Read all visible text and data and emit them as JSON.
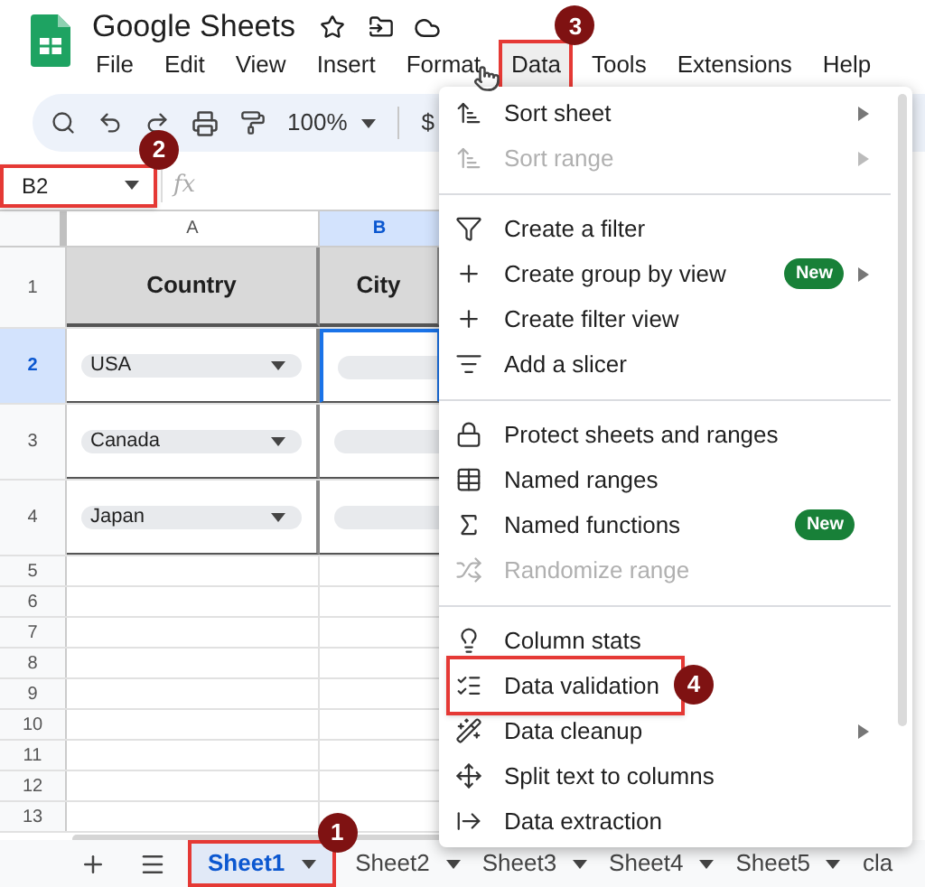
{
  "app": {
    "title": "Google Sheets",
    "menu": [
      {
        "label": "File"
      },
      {
        "label": "Edit"
      },
      {
        "label": "View"
      },
      {
        "label": "Insert"
      },
      {
        "label": "Format"
      },
      {
        "label": "Data",
        "callout": "3"
      },
      {
        "label": "Tools"
      },
      {
        "label": "Extensions"
      },
      {
        "label": "Help"
      }
    ]
  },
  "toolbar": {
    "zoom": "100%",
    "currency": "$"
  },
  "name_box": {
    "value": "B2",
    "callout": "2"
  },
  "formula_bar": {
    "label": "fx"
  },
  "grid": {
    "columns": [
      {
        "label": "A",
        "selected": false
      },
      {
        "label": "B",
        "selected": true
      }
    ],
    "rows": [
      {
        "label": "1",
        "selected": false,
        "kind": "header",
        "cells": [
          "Country",
          "City"
        ]
      },
      {
        "label": "2",
        "selected": true,
        "kind": "chips",
        "cells": [
          "USA"
        ]
      },
      {
        "label": "3",
        "selected": false,
        "kind": "chips",
        "cells": [
          "Canada"
        ]
      },
      {
        "label": "4",
        "selected": false,
        "kind": "chips",
        "cells": [
          "Japan"
        ]
      },
      {
        "label": "5",
        "selected": false,
        "kind": "empty"
      },
      {
        "label": "6",
        "selected": false,
        "kind": "empty"
      },
      {
        "label": "7",
        "selected": false,
        "kind": "empty"
      },
      {
        "label": "8",
        "selected": false,
        "kind": "empty"
      },
      {
        "label": "9",
        "selected": false,
        "kind": "empty"
      },
      {
        "label": "10",
        "selected": false,
        "kind": "empty"
      },
      {
        "label": "11",
        "selected": false,
        "kind": "empty"
      },
      {
        "label": "12",
        "selected": false,
        "kind": "empty"
      },
      {
        "label": "13",
        "selected": false,
        "kind": "empty"
      }
    ]
  },
  "data_menu": {
    "groups": [
      [
        {
          "label": "Sort sheet",
          "disabled": false,
          "submenu": true
        },
        {
          "label": "Sort range",
          "disabled": true,
          "submenu": true
        }
      ],
      [
        {
          "label": "Create a filter",
          "disabled": false,
          "submenu": false
        },
        {
          "label": "Create group by view",
          "disabled": false,
          "submenu": true,
          "badge": "New"
        },
        {
          "label": "Create filter view",
          "disabled": false,
          "submenu": false
        },
        {
          "label": "Add a slicer",
          "disabled": false,
          "submenu": false
        }
      ],
      [
        {
          "label": "Protect sheets and ranges",
          "disabled": false,
          "submenu": false
        },
        {
          "label": "Named ranges",
          "disabled": false,
          "submenu": false
        },
        {
          "label": "Named functions",
          "disabled": false,
          "submenu": false,
          "badge": "New"
        },
        {
          "label": "Randomize range",
          "disabled": true,
          "submenu": false
        }
      ],
      [
        {
          "label": "Column stats",
          "disabled": false,
          "submenu": false
        },
        {
          "label": "Data validation",
          "disabled": false,
          "submenu": false,
          "callout": "4"
        },
        {
          "label": "Data cleanup",
          "disabled": false,
          "submenu": true
        },
        {
          "label": "Split text to columns",
          "disabled": false,
          "submenu": false
        },
        {
          "label": "Data extraction",
          "disabled": false,
          "submenu": false
        }
      ]
    ]
  },
  "sheet_tabs": [
    {
      "label": "Sheet1",
      "selected": true,
      "dropdown": true,
      "callout": "1"
    },
    {
      "label": "Sheet2",
      "selected": false,
      "dropdown": true
    },
    {
      "label": "Sheet3",
      "selected": false,
      "dropdown": true
    },
    {
      "label": "Sheet4",
      "selected": false,
      "dropdown": true
    },
    {
      "label": "Sheet5",
      "selected": false,
      "dropdown": true
    },
    {
      "label": "cla",
      "selected": false,
      "dropdown": false
    }
  ]
}
